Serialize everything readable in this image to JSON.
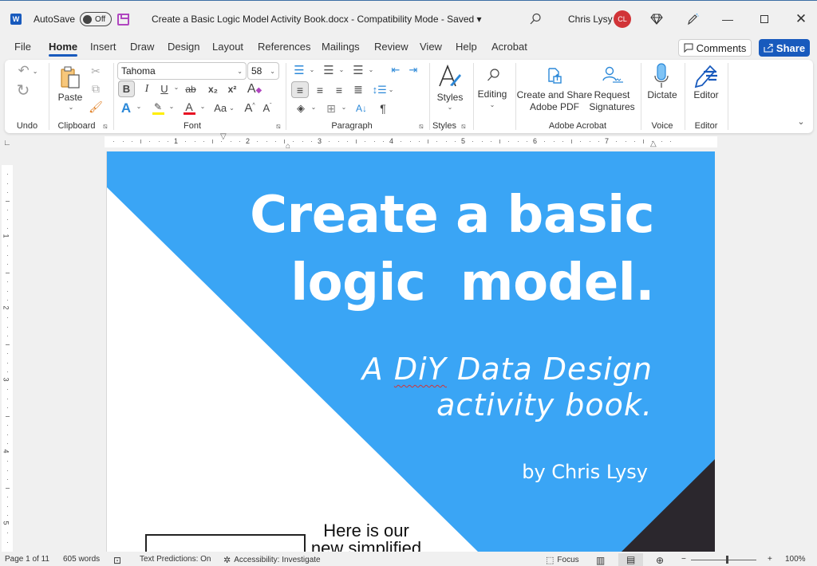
{
  "titlebar": {
    "app_icon": "word-icon",
    "autosave_label": "AutoSave",
    "autosave_state": "Off",
    "document_title": "Create a Basic Logic Model Activity Book.docx  -  Compatibility Mode  -  Saved ▾",
    "user_name": "Chris Lysy",
    "user_initials": "CL",
    "avatar_color": "#d13438"
  },
  "menu": {
    "tabs": [
      "File",
      "Home",
      "Insert",
      "Draw",
      "Design",
      "Layout",
      "References",
      "Mailings",
      "Review",
      "View",
      "Help",
      "Acrobat"
    ],
    "active_tab": "Home",
    "comments_label": "Comments",
    "share_label": "Share",
    "accent_color": "#185abd"
  },
  "ribbon": {
    "groups": {
      "undo": "Undo",
      "clipboard": "Clipboard",
      "font": "Font",
      "paragraph": "Paragraph",
      "styles": "Styles",
      "adobe": "Adobe Acrobat",
      "voice": "Voice",
      "editor": "Editor"
    },
    "paste_label": "Paste",
    "font_name": "Tahoma",
    "font_size": "58",
    "styles_label": "Styles",
    "editing_label": "Editing",
    "create_share_label_1": "Create and Share",
    "create_share_label_2": "Adobe PDF",
    "request_sig_label_1": "Request",
    "request_sig_label_2": "Signatures",
    "dictate_label": "Dictate",
    "editor_label": "Editor",
    "change_case_label": "Aa",
    "bold_label": "B",
    "italic_label": "I",
    "underline_label": "U",
    "strike_label": "ab",
    "subscript_label": "x₂",
    "superscript_label": "x²"
  },
  "ruler": {
    "horizontal_numbers": [
      "1",
      "2",
      "3",
      "4",
      "5",
      "6",
      "7"
    ],
    "vertical_numbers": [
      "1",
      "2",
      "3",
      "4",
      "5"
    ]
  },
  "document": {
    "title_line_1": "Create a basic",
    "title_line_2": "logic  model.",
    "subtitle_prefix": "A ",
    "subtitle_misspelled": "DiY",
    "subtitle_suffix": " Data Design",
    "subtitle_line_2": "activity book.",
    "byline": "by Chris Lysy",
    "body_text_line_1": "Here is our",
    "body_text_line_2": "new simplified",
    "colors": {
      "blue": "#3aa5f5",
      "dark": "#2b272d",
      "white": "#ffffff"
    }
  },
  "statusbar": {
    "page": "Page 1 of 11",
    "words": "605 words",
    "text_predictions": "Text Predictions: On",
    "accessibility": "Accessibility: Investigate",
    "focus": "Focus",
    "zoom_level": "100%",
    "zoom_percent": 100
  }
}
